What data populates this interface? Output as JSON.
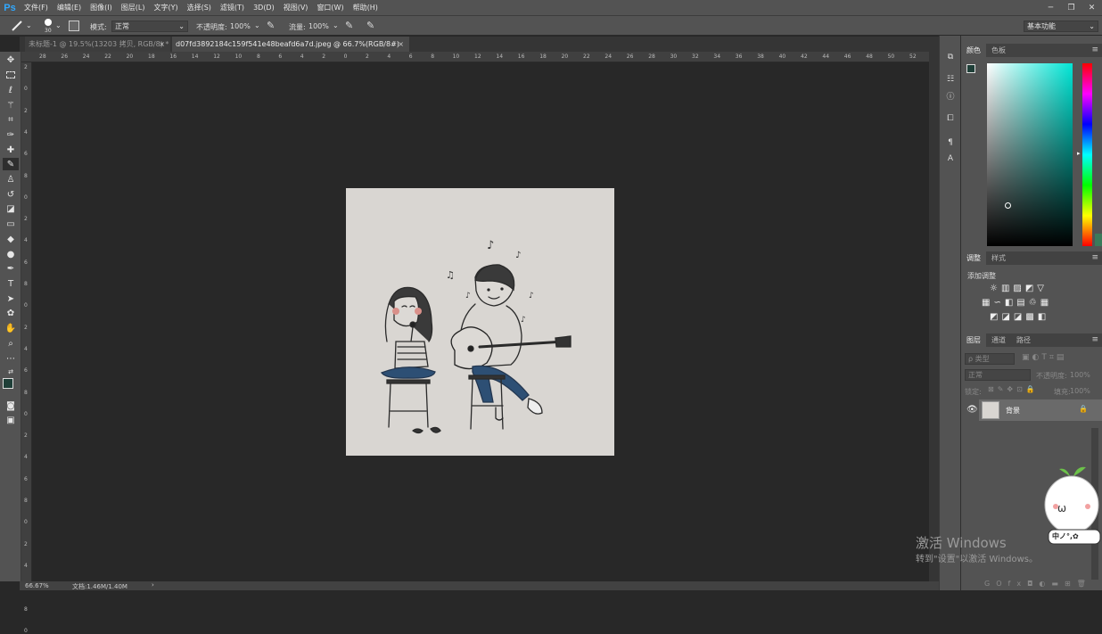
{
  "app": {
    "logo": "Ps"
  },
  "menus": [
    "文件(F)",
    "编辑(E)",
    "图像(I)",
    "图层(L)",
    "文字(Y)",
    "选择(S)",
    "滤镜(T)",
    "3D(D)",
    "视图(V)",
    "窗口(W)",
    "帮助(H)"
  ],
  "window_buttons": [
    "─",
    "❐",
    "✕"
  ],
  "options": {
    "brush_size": "30",
    "mode_label": "模式:",
    "mode_value": "正常",
    "opacity_label": "不透明度:",
    "opacity_value": "100%",
    "flow_label": "流量:",
    "flow_value": "100%",
    "workspace": "基本功能"
  },
  "tabs": [
    {
      "label": "未标题-1 @ 19.5%(13203 拷贝, RGB/8) *",
      "close": "×"
    },
    {
      "label": "d07fd3892184c159f541e48beafd6a7d.jpeg @ 66.7%(RGB/8#)",
      "close": "×"
    }
  ],
  "ruler_top_labels": [
    "28",
    "26",
    "24",
    "22",
    "20",
    "18",
    "16",
    "14",
    "12",
    "10",
    "8",
    "6",
    "4",
    "2",
    "0",
    "2",
    "4",
    "6",
    "8",
    "10",
    "12",
    "14",
    "16",
    "18",
    "20",
    "22",
    "24",
    "26",
    "28",
    "30",
    "32",
    "34",
    "36",
    "38",
    "40",
    "42",
    "44",
    "46",
    "48",
    "50",
    "52"
  ],
  "ruler_left_labels": [
    "2",
    "0",
    "2",
    "4",
    "6",
    "8",
    "0",
    "2",
    "4",
    "6",
    "8",
    "0",
    "2",
    "4",
    "6",
    "8",
    "0",
    "2",
    "4",
    "6",
    "8",
    "0",
    "2",
    "4",
    "6",
    "8",
    "0"
  ],
  "status": {
    "zoom": "66.67%",
    "doc": "文档:1.46M/1.40M"
  },
  "panels": {
    "color_tabs": [
      "颜色",
      "色板"
    ],
    "adjust_tabs": [
      "调整",
      "样式"
    ],
    "adjust_title": "添加调整",
    "layers_tabs": [
      "图层",
      "通道",
      "路径"
    ],
    "layer_filter": "ρ 类型",
    "layer_mode": "正常",
    "layer_opacity_label": "不透明度:",
    "layer_opacity_value": "100%",
    "lock_label": "锁定:",
    "fill_label": "填充:",
    "fill_value": "100%",
    "layer_name": "背景",
    "footer_icons": [
      "GO",
      "fx"
    ]
  },
  "watermark": {
    "line1": "激活 Windows",
    "line2": "转到\"设置\"以激活 Windows。"
  },
  "mascot_text": "中ノ°,✿",
  "colors": {
    "accent": "#31a8ff",
    "ui_bg": "#535353",
    "canvas_bg": "#282828",
    "paper": "#d9d6d2"
  }
}
